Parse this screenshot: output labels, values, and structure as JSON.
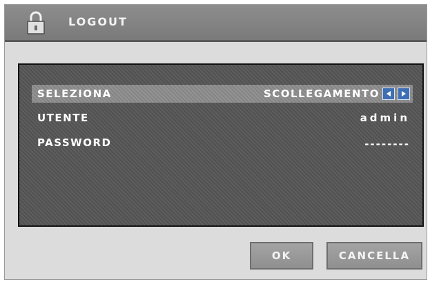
{
  "title_bar": {
    "title": "LOGOUT",
    "icon": "lock-icon"
  },
  "form": {
    "rows": [
      {
        "label": "SELEZIONA",
        "value": "SCOLLEGAMENTO",
        "selected": true
      },
      {
        "label": "UTENTE",
        "value": "admin"
      },
      {
        "label": "PASSWORD",
        "value": "--------"
      }
    ],
    "arrows": {
      "left_icon": "arrow-left-icon",
      "right_icon": "arrow-right-icon"
    }
  },
  "buttons": {
    "ok_label": "OK",
    "cancel_label": "CANCELLA"
  },
  "colors": {
    "title_bar": "#828282",
    "background": "#dcdcdc",
    "panel": "#555555",
    "selected_row": "#8c8c8c",
    "arrow_button": "#3f6fb3",
    "text": "#ffffff"
  }
}
